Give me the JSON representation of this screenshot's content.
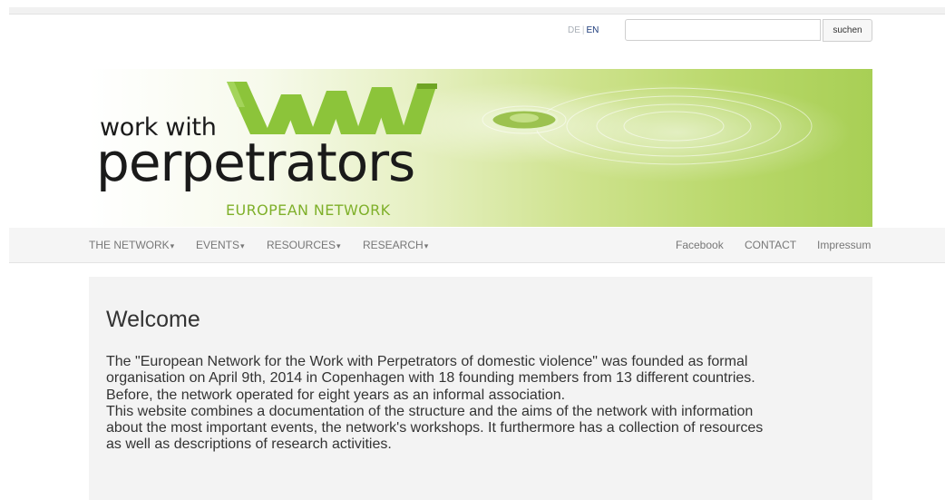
{
  "header": {
    "lang_de": "DE",
    "lang_sep": "|",
    "lang_en": "EN",
    "search_value": "",
    "search_button": "suchen"
  },
  "logo": {
    "line1": "work with",
    "line2": "perpetrators",
    "line3": "EUROPEAN NETWORK"
  },
  "nav": {
    "left": [
      {
        "label": "THE NETWORK"
      },
      {
        "label": "EVENTS"
      },
      {
        "label": "RESOURCES"
      },
      {
        "label": "RESEARCH"
      }
    ],
    "caret": "▾",
    "right": [
      {
        "label": "Facebook"
      },
      {
        "label": "CONTACT"
      },
      {
        "label": "Impressum"
      }
    ]
  },
  "main": {
    "title": "Welcome",
    "lines": [
      "The \"European Network for the Work with Perpetrators of domestic violence\" was founded as formal",
      "organisation on April 9th, 2014 in Copenhagen with 18 founding members from 13 different countries.",
      "Before, the network operated for eight years as an informal association.",
      "This website combines a documentation of the structure and the aims of the network with information",
      "about the most important events, the network's workshops. It furthermore has a collection of resources",
      "as well as descriptions of research activities."
    ]
  },
  "colors": {
    "brand_green": "#8cc43a",
    "dark_green": "#6fa424",
    "accent_blue": "#1b3a7a",
    "jumbotron_bg": "#f3f3f3"
  }
}
